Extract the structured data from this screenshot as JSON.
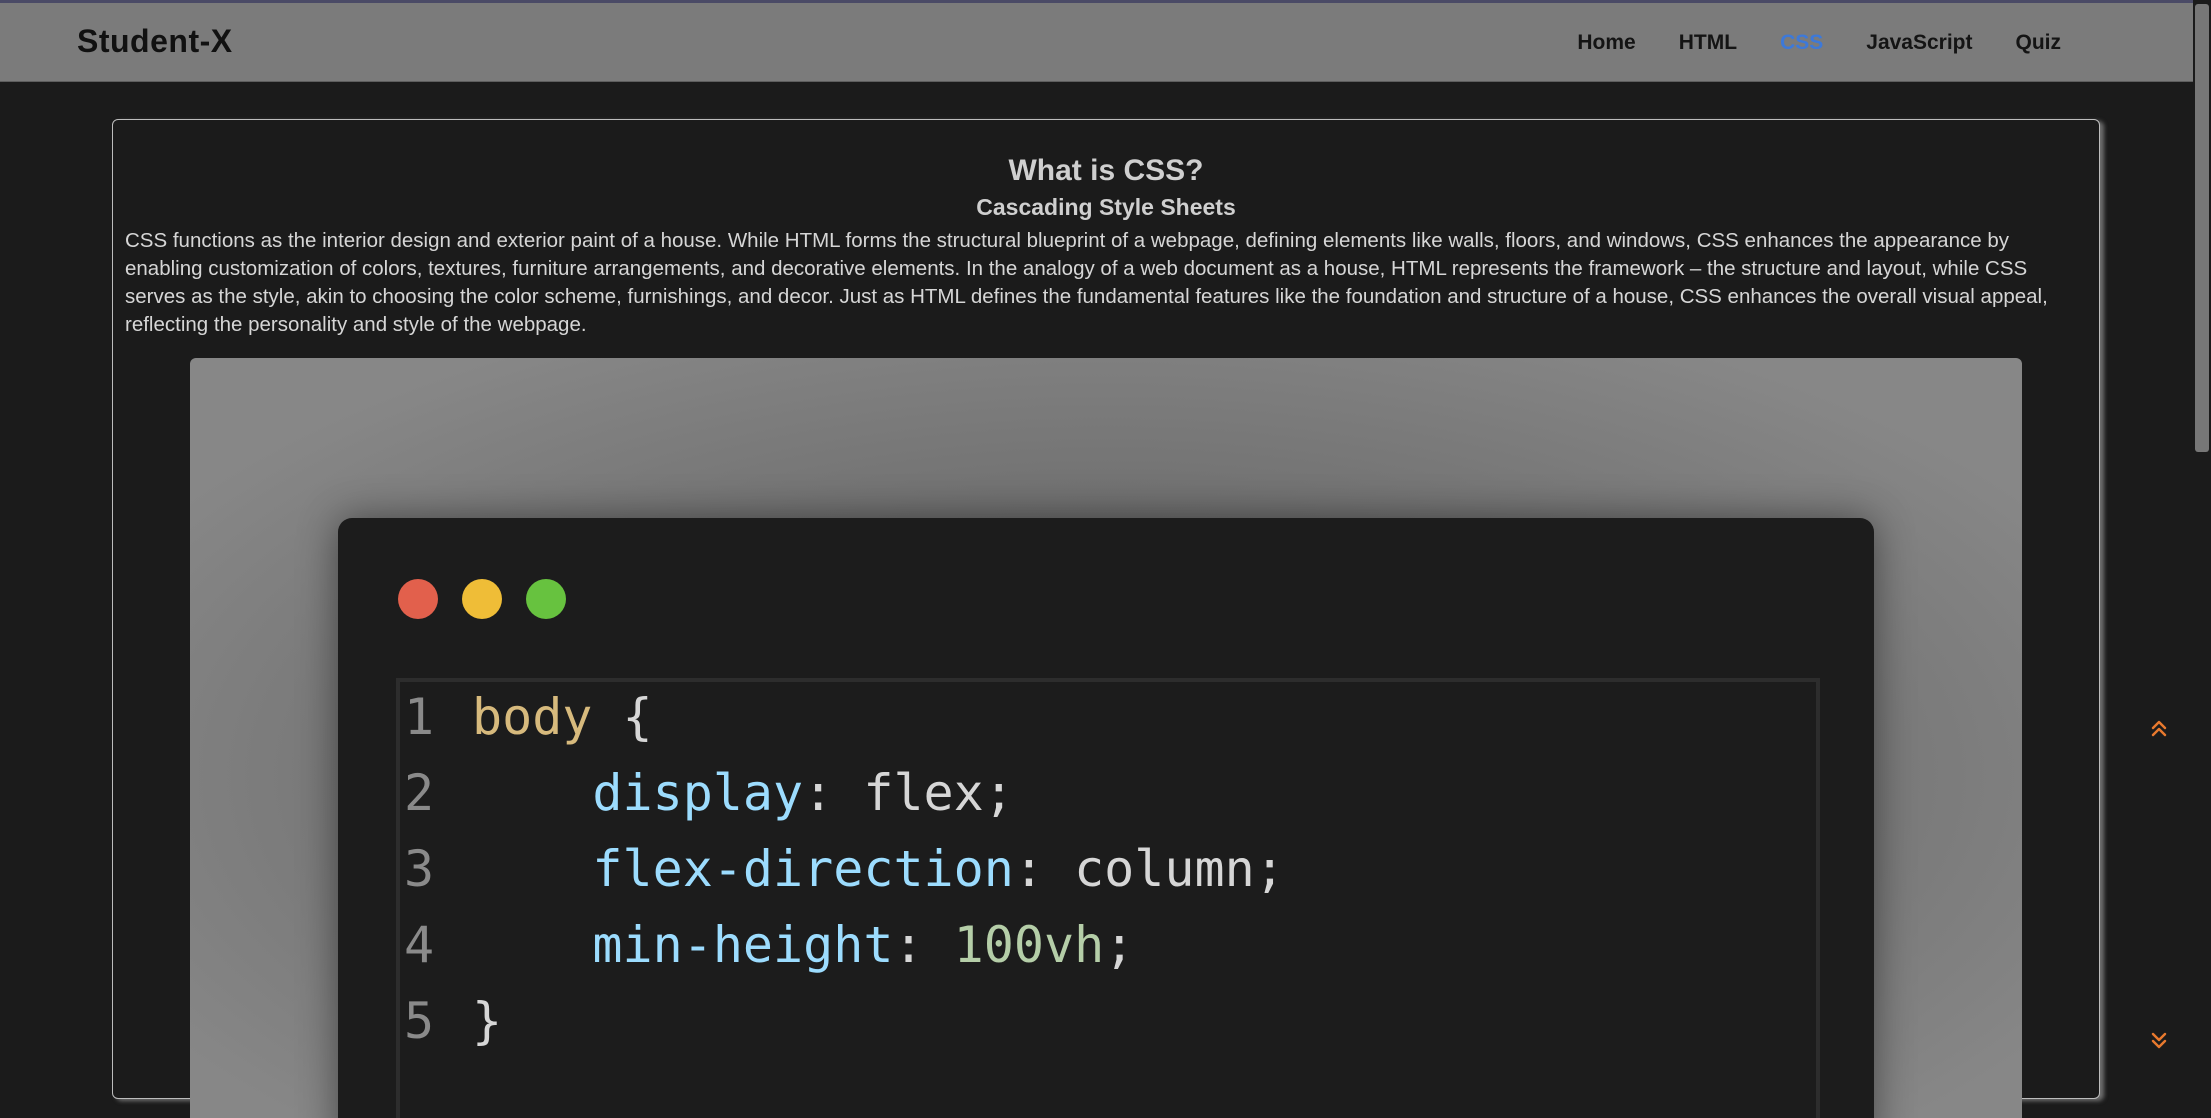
{
  "navbar": {
    "brand": "Student-X",
    "links": [
      {
        "label": "Home",
        "active": false
      },
      {
        "label": "HTML",
        "active": false
      },
      {
        "label": "CSS",
        "active": true
      },
      {
        "label": "JavaScript",
        "active": false
      },
      {
        "label": "Quiz",
        "active": false
      }
    ]
  },
  "article": {
    "title": "What is CSS?",
    "subtitle": "Cascading Style Sheets",
    "body": "CSS functions as the interior design and exterior paint of a house. While HTML forms the structural blueprint of a webpage, defining elements like walls, floors, and windows, CSS enhances the appearance by enabling customization of colors, textures, furniture arrangements, and decorative elements. In the analogy of a web document as a house, HTML represents the framework – the structure and layout, while CSS serves as the style, akin to choosing the color scheme, furnishings, and decor. Just as HTML defines the fundamental features like the foundation and structure of a house, CSS enhances the overall visual appeal, reflecting the personality and style of the webpage."
  },
  "code_image": {
    "lines": [
      {
        "num": "1",
        "parts": [
          {
            "t": "body",
            "c": "sel"
          },
          {
            "t": " {",
            "c": ""
          }
        ]
      },
      {
        "num": "2",
        "parts": [
          {
            "t": "    ",
            "c": ""
          },
          {
            "t": "display",
            "c": "prop"
          },
          {
            "t": ": flex;",
            "c": ""
          }
        ]
      },
      {
        "num": "3",
        "parts": [
          {
            "t": "    ",
            "c": ""
          },
          {
            "t": "flex-direction",
            "c": "prop"
          },
          {
            "t": ": column;",
            "c": ""
          }
        ]
      },
      {
        "num": "4",
        "parts": [
          {
            "t": "    ",
            "c": ""
          },
          {
            "t": "min-height",
            "c": "prop"
          },
          {
            "t": ": ",
            "c": ""
          },
          {
            "t": "100vh",
            "c": "num"
          },
          {
            "t": ";",
            "c": ""
          }
        ]
      },
      {
        "num": "5",
        "parts": [
          {
            "t": "}",
            "c": ""
          }
        ]
      }
    ]
  },
  "icons": {
    "scroll_up": "double-chevron-up-icon",
    "scroll_down": "double-chevron-down-icon"
  },
  "colors": {
    "accent": "#3d79d9",
    "scroll_buttons": "#e8792e",
    "window_red": "#e2604c",
    "window_yellow": "#efbd37",
    "window_green": "#67c23f"
  }
}
